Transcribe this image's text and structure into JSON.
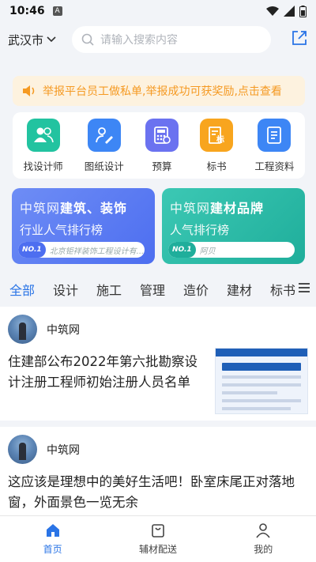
{
  "status": {
    "time": "10:46",
    "a_badge": "A"
  },
  "topbar": {
    "city": "武汉市",
    "search_placeholder": "请输入搜索内容"
  },
  "notice": {
    "text": "举报平台员工做私单,举报成功可获奖励,点击查看"
  },
  "categories": [
    {
      "label": "找设计师",
      "icon": "designer-icon",
      "color": "#22c3a0"
    },
    {
      "label": "图纸设计",
      "icon": "drawing-icon",
      "color": "#3d86f5"
    },
    {
      "label": "预算",
      "icon": "budget-icon",
      "color": "#6b72f0"
    },
    {
      "label": "标书",
      "icon": "tender-icon",
      "color": "#f8a51e"
    },
    {
      "label": "工程资料",
      "icon": "docs-icon",
      "color": "#3d86f5"
    }
  ],
  "banners": [
    {
      "brand": "中筑网",
      "headline": "建筑、装饰",
      "sub": "行业人气排行榜",
      "badge": "NO.1",
      "top_item": "北京钜祥装饰工程设计有..."
    },
    {
      "brand": "中筑网",
      "headline": "建材品牌",
      "sub": "人气排行榜",
      "badge": "NO.1",
      "top_item": "阿贝"
    }
  ],
  "tabs": [
    "全部",
    "设计",
    "施工",
    "管理",
    "造价",
    "建材",
    "标书"
  ],
  "posts": [
    {
      "author": "中筑网",
      "title": "住建部公布2022年第六批勘察设计注册工程师初始注册人员名单"
    },
    {
      "author": "中筑网",
      "title": "这应该是理想中的美好生活吧！卧室床尾正对落地窗，外面景色一览无余"
    }
  ],
  "bottom_nav": [
    {
      "label": "首页"
    },
    {
      "label": "辅材配送"
    },
    {
      "label": "我的"
    }
  ],
  "colors": {
    "accent": "#2a74e6",
    "notice": "#f59a23"
  }
}
